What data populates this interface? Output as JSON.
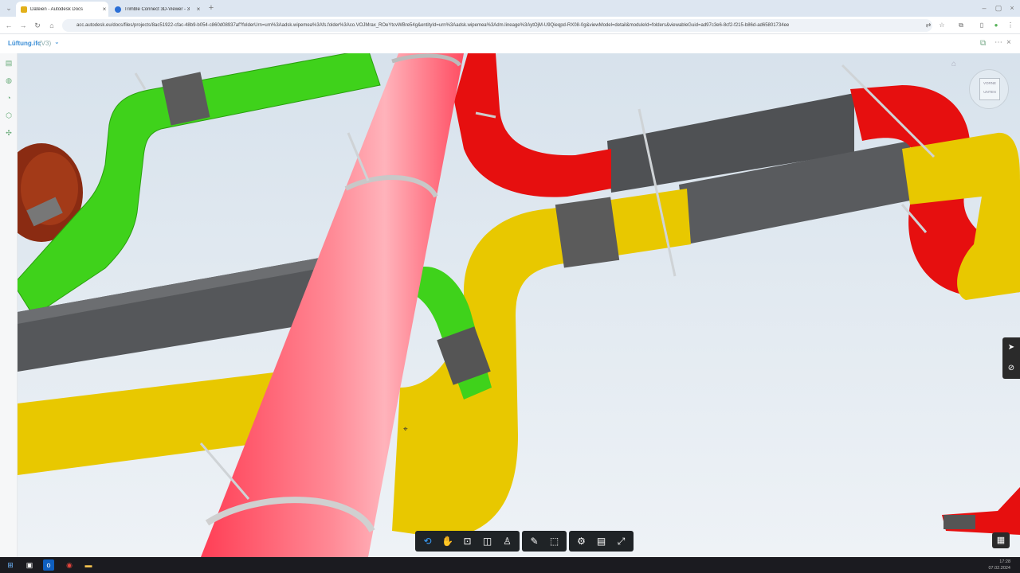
{
  "browser": {
    "tabs": [
      {
        "title": "Dateien - Autodesk Docs",
        "favicon_color": "#e2b01a",
        "active": true
      },
      {
        "title": "Trimble Connect 3D-Viewer - 3",
        "favicon_color": "#2b6fd6",
        "active": false
      }
    ],
    "new_tab": "+",
    "url": "acc.autodesk.eu/docs/files/projects/8ac51922-cfac-48b9-b054-c860d08937af?folderUrn=urn%3Aadsk.wipemea%3Afs.folder%3Aco.VOJMrax_ROeYtcvWBre54g&entityId=urn%3Aadsk.wipemea%3Adm.lineage%3AytOjM-U9Qieqpd-RX08-0g&viewModel=detail&moduleId=folders&viewableGuid=ad97c3e6-8cf2-f215-b86d-ad65801734ee"
  },
  "app": {
    "model_name": "Lüftung.ifc",
    "model_version": "(V3)",
    "version_chevron": "⌄"
  },
  "left_rail": [
    "layers-icon",
    "globe-icon",
    "check-circle-icon",
    "cube-icon",
    "sitemap-icon"
  ],
  "viewcube": {
    "top_label": "VORNE",
    "bottom_label": "UNTEN"
  },
  "toolbar": {
    "groups": [
      [
        {
          "name": "orbit-icon",
          "glyph": "⟲",
          "active": true
        },
        {
          "name": "pan-hand-icon",
          "glyph": "✋"
        },
        {
          "name": "fit-view-icon",
          "glyph": "⊡"
        },
        {
          "name": "camera-icon",
          "glyph": "◫"
        },
        {
          "name": "walk-icon",
          "glyph": "♙"
        }
      ],
      [
        {
          "name": "measure-icon",
          "glyph": "✎"
        },
        {
          "name": "section-box-icon",
          "glyph": "⬚"
        }
      ],
      [
        {
          "name": "settings-gear-icon",
          "glyph": "⚙"
        },
        {
          "name": "properties-icon",
          "glyph": "▤"
        },
        {
          "name": "fullscreen-icon",
          "glyph": "⤢"
        }
      ]
    ]
  },
  "right_panel": [
    "cursor-select-icon",
    "check-circle-icon"
  ],
  "taskbar": {
    "icons": [
      "windows-start-icon",
      "task-view-icon",
      "outlook-icon",
      "chrome-icon",
      "file-explorer-icon"
    ],
    "time": "17:28",
    "date": "07.02.2024"
  },
  "colors": {
    "green": "#3fd21b",
    "red": "#e60f0f",
    "yellow": "#e8c800",
    "gray": "#6a6a6a",
    "pink": "#ff5a6e",
    "accent": "#3aa0ff"
  }
}
